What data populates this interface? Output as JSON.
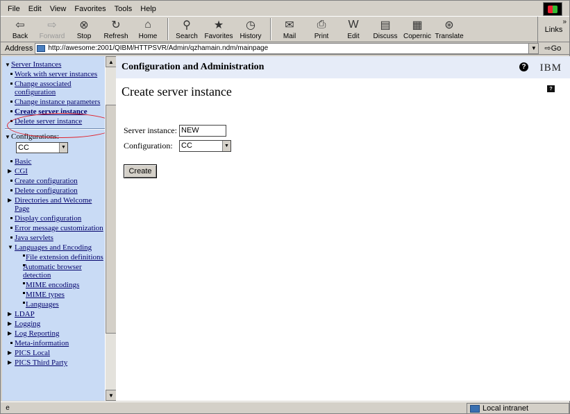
{
  "menu": [
    "File",
    "Edit",
    "View",
    "Favorites",
    "Tools",
    "Help"
  ],
  "toolbar": {
    "buttons": [
      {
        "label": "Back",
        "icon": "back-arrow-icon",
        "glyph": "⇦",
        "disabled": false
      },
      {
        "label": "Forward",
        "icon": "forward-arrow-icon",
        "glyph": "⇨",
        "disabled": true
      },
      {
        "label": "Stop",
        "icon": "stop-icon",
        "glyph": "⊗",
        "disabled": false
      },
      {
        "label": "Refresh",
        "icon": "refresh-icon",
        "glyph": "↻",
        "disabled": false
      },
      {
        "label": "Home",
        "icon": "home-icon",
        "glyph": "⌂",
        "disabled": false
      },
      {
        "label": "Search",
        "icon": "search-icon",
        "glyph": "⚲",
        "disabled": false
      },
      {
        "label": "Favorites",
        "icon": "favorites-icon",
        "glyph": "★",
        "disabled": false
      },
      {
        "label": "History",
        "icon": "history-icon",
        "glyph": "◷",
        "disabled": false
      },
      {
        "label": "Mail",
        "icon": "mail-icon",
        "glyph": "✉",
        "disabled": false
      },
      {
        "label": "Print",
        "icon": "print-icon",
        "glyph": "⎙",
        "disabled": false
      },
      {
        "label": "Edit",
        "icon": "edit-icon",
        "glyph": "W",
        "disabled": false
      },
      {
        "label": "Discuss",
        "icon": "discuss-icon",
        "glyph": "▤",
        "disabled": false
      },
      {
        "label": "Copernic",
        "icon": "copernic-icon",
        "glyph": "▦",
        "disabled": false
      },
      {
        "label": "Translate",
        "icon": "translate-icon",
        "glyph": "⊛",
        "disabled": false
      }
    ],
    "links_label": "Links"
  },
  "address": {
    "label": "Address",
    "url": "http://awesome:2001/QIBM/HTTPSVR/Admin/qzhamain.ndm/mainpage",
    "go_label": "Go"
  },
  "nav": {
    "server_instances": {
      "title": "Server Instances",
      "items": [
        "Work with server instances",
        "Change associated configuration",
        "Change instance parameters",
        "Create server instance",
        "Delete server instance"
      ]
    },
    "configurations": {
      "title": "Configurations:",
      "selected": "CC",
      "items": [
        "Basic",
        "CGI",
        "Create configuration",
        "Delete configuration",
        "Directories and Welcome Page",
        "Display configuration",
        "Error message customization",
        "Java servlets",
        "Languages and Encoding"
      ],
      "languages_sub": [
        "File extension definitions",
        "Automatic browser detection",
        "MIME encodings",
        "MIME types",
        "Languages"
      ],
      "more_items": [
        "LDAP",
        "Logging",
        "Log Reporting",
        "Meta-information",
        "PICS Local",
        "PICS Third Party"
      ]
    }
  },
  "content": {
    "header_title": "Configuration and Administration",
    "help": "?",
    "logo": "IBM",
    "page_title": "Create server instance",
    "form": {
      "server_instance_label": "Server instance:",
      "server_instance_value": "NEW",
      "configuration_label": "Configuration:",
      "configuration_value": "CC",
      "create_label": "Create"
    }
  },
  "status": {
    "zone": "Local intranet"
  }
}
